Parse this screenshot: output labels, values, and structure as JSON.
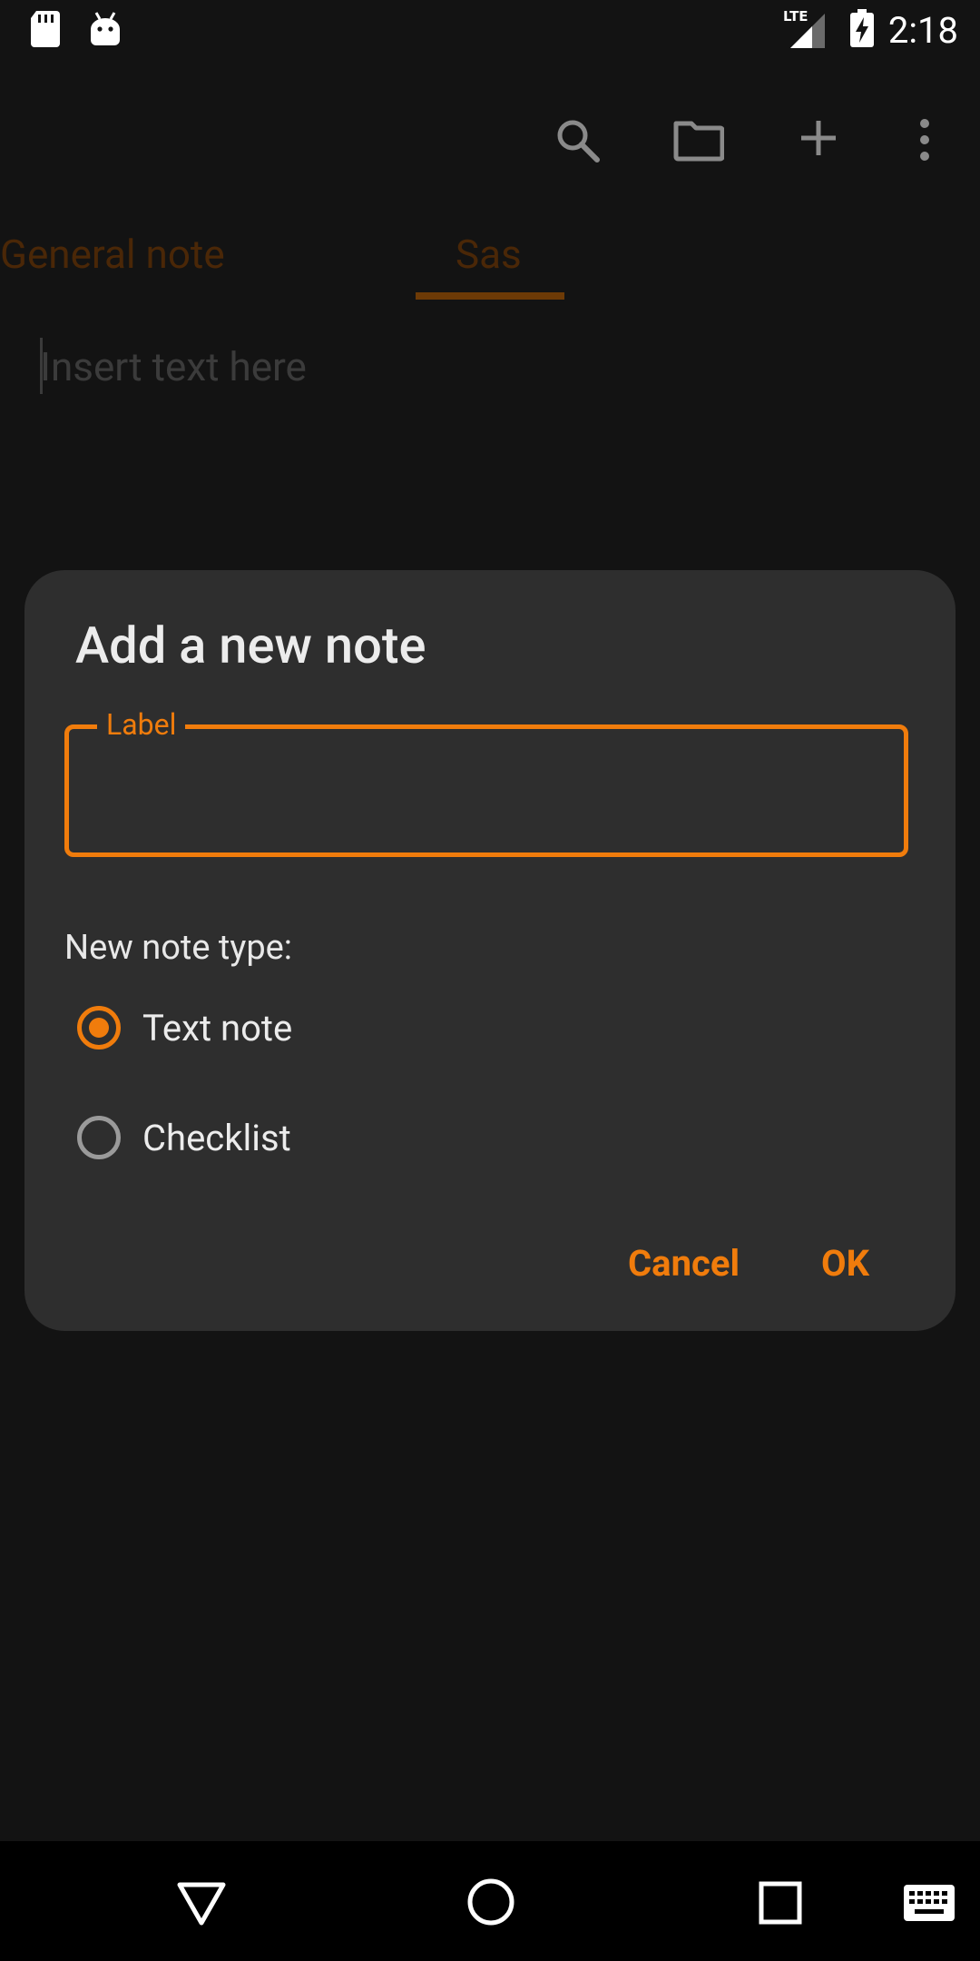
{
  "status_bar": {
    "time": "2:18",
    "network": "LTE",
    "icons": [
      "sd-card-icon",
      "android-icon",
      "lte-signal-icon",
      "battery-charging-icon"
    ]
  },
  "toolbar": {
    "icons": [
      "search-icon",
      "folder-icon",
      "add-icon",
      "more-vert-icon"
    ]
  },
  "tabs": [
    {
      "label": "General note",
      "selected": false
    },
    {
      "label": "Sas",
      "selected": true
    }
  ],
  "editor": {
    "placeholder": "Insert text here"
  },
  "dialog": {
    "title": "Add a new note",
    "label_field": {
      "legend": "Label",
      "value": ""
    },
    "type_heading": "New note type:",
    "options": [
      {
        "label": "Text note",
        "selected": true
      },
      {
        "label": "Checklist",
        "selected": false
      }
    ],
    "cancel_label": "Cancel",
    "ok_label": "OK"
  },
  "navbar": {
    "icons": [
      "back-icon",
      "home-icon",
      "recents-icon",
      "keyboard-icon"
    ]
  },
  "colors": {
    "accent": "#f07c0c",
    "background": "#131313",
    "dialog": "#2e2e2e"
  }
}
